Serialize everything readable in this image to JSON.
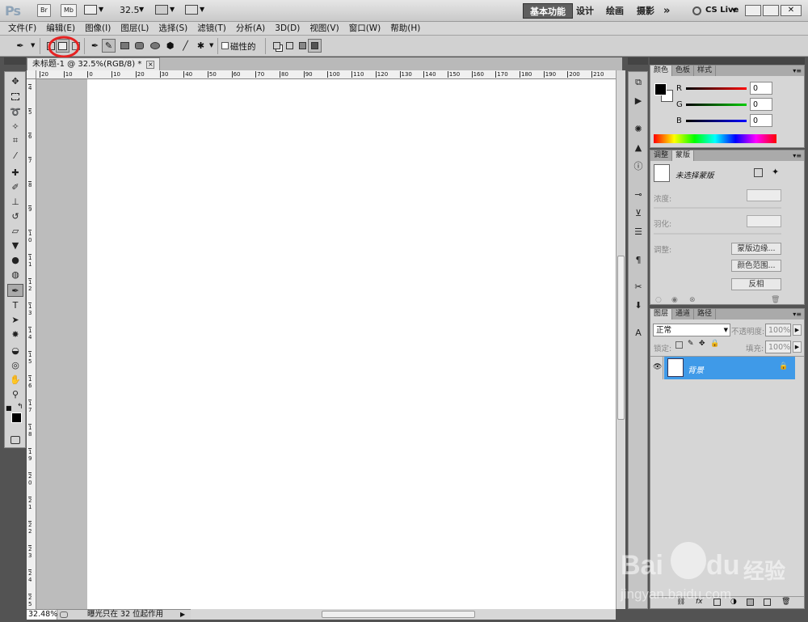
{
  "appbar": {
    "logo": "Ps",
    "br": "Br",
    "mb": "Mb",
    "zoom": "32.5",
    "workspaces": [
      "基本功能",
      "设计",
      "绘画",
      "摄影"
    ],
    "more": "»",
    "cslive": "CS Live"
  },
  "menu": [
    "文件(F)",
    "编辑(E)",
    "图像(I)",
    "图层(L)",
    "选择(S)",
    "滤镜(T)",
    "分析(A)",
    "3D(D)",
    "视图(V)",
    "窗口(W)",
    "帮助(H)"
  ],
  "options": {
    "magnetic_label": "磁性的"
  },
  "document": {
    "tab_title": "未标题-1 @ 32.5%(RGB/8) *",
    "close": "×"
  },
  "rulers": {
    "h_ticks": [
      "20",
      "10",
      "0",
      "10",
      "20",
      "30",
      "40",
      "50",
      "60",
      "70",
      "80",
      "90",
      "100",
      "110",
      "120",
      "130",
      "140",
      "150",
      "160",
      "170",
      "180",
      "190",
      "200",
      "210"
    ],
    "v_ticks": [
      "4",
      "5",
      "6",
      "7",
      "8",
      "9",
      "10",
      "11",
      "12",
      "13",
      "14",
      "15",
      "16",
      "17",
      "18",
      "19",
      "20",
      "21",
      "22",
      "23",
      "24",
      "25"
    ]
  },
  "status": {
    "zoom": "32.48%",
    "message": "曝光只在 32 位起作用"
  },
  "color_panel": {
    "tabs": [
      "颜色",
      "色板",
      "样式"
    ],
    "channels": [
      {
        "name": "R",
        "value": "0"
      },
      {
        "name": "G",
        "value": "0"
      },
      {
        "name": "B",
        "value": "0"
      }
    ]
  },
  "mask_panel": {
    "tabs": [
      "调整",
      "蒙版"
    ],
    "title": "未选择蒙版",
    "density_label": "浓度:",
    "feather_label": "羽化:",
    "refine_label": "调整:",
    "buttons": [
      "蒙版边缘...",
      "颜色范围...",
      "反相"
    ]
  },
  "layers_panel": {
    "tabs": [
      "图层",
      "通道",
      "路径"
    ],
    "blend_mode": "正常",
    "opacity_label": "不透明度:",
    "opacity": "100%",
    "lock_label": "锁定:",
    "fill_label": "填充:",
    "fill": "100%",
    "layers": [
      {
        "name": "背景"
      }
    ],
    "footer_fx": "fx"
  },
  "watermark": {
    "brand": "Bai",
    "brand2": "du",
    "cn": "经验",
    "url": "jingyan.baidu.com"
  },
  "colors": {
    "accent": "#3f9ae8",
    "annotation": "#e52222"
  }
}
